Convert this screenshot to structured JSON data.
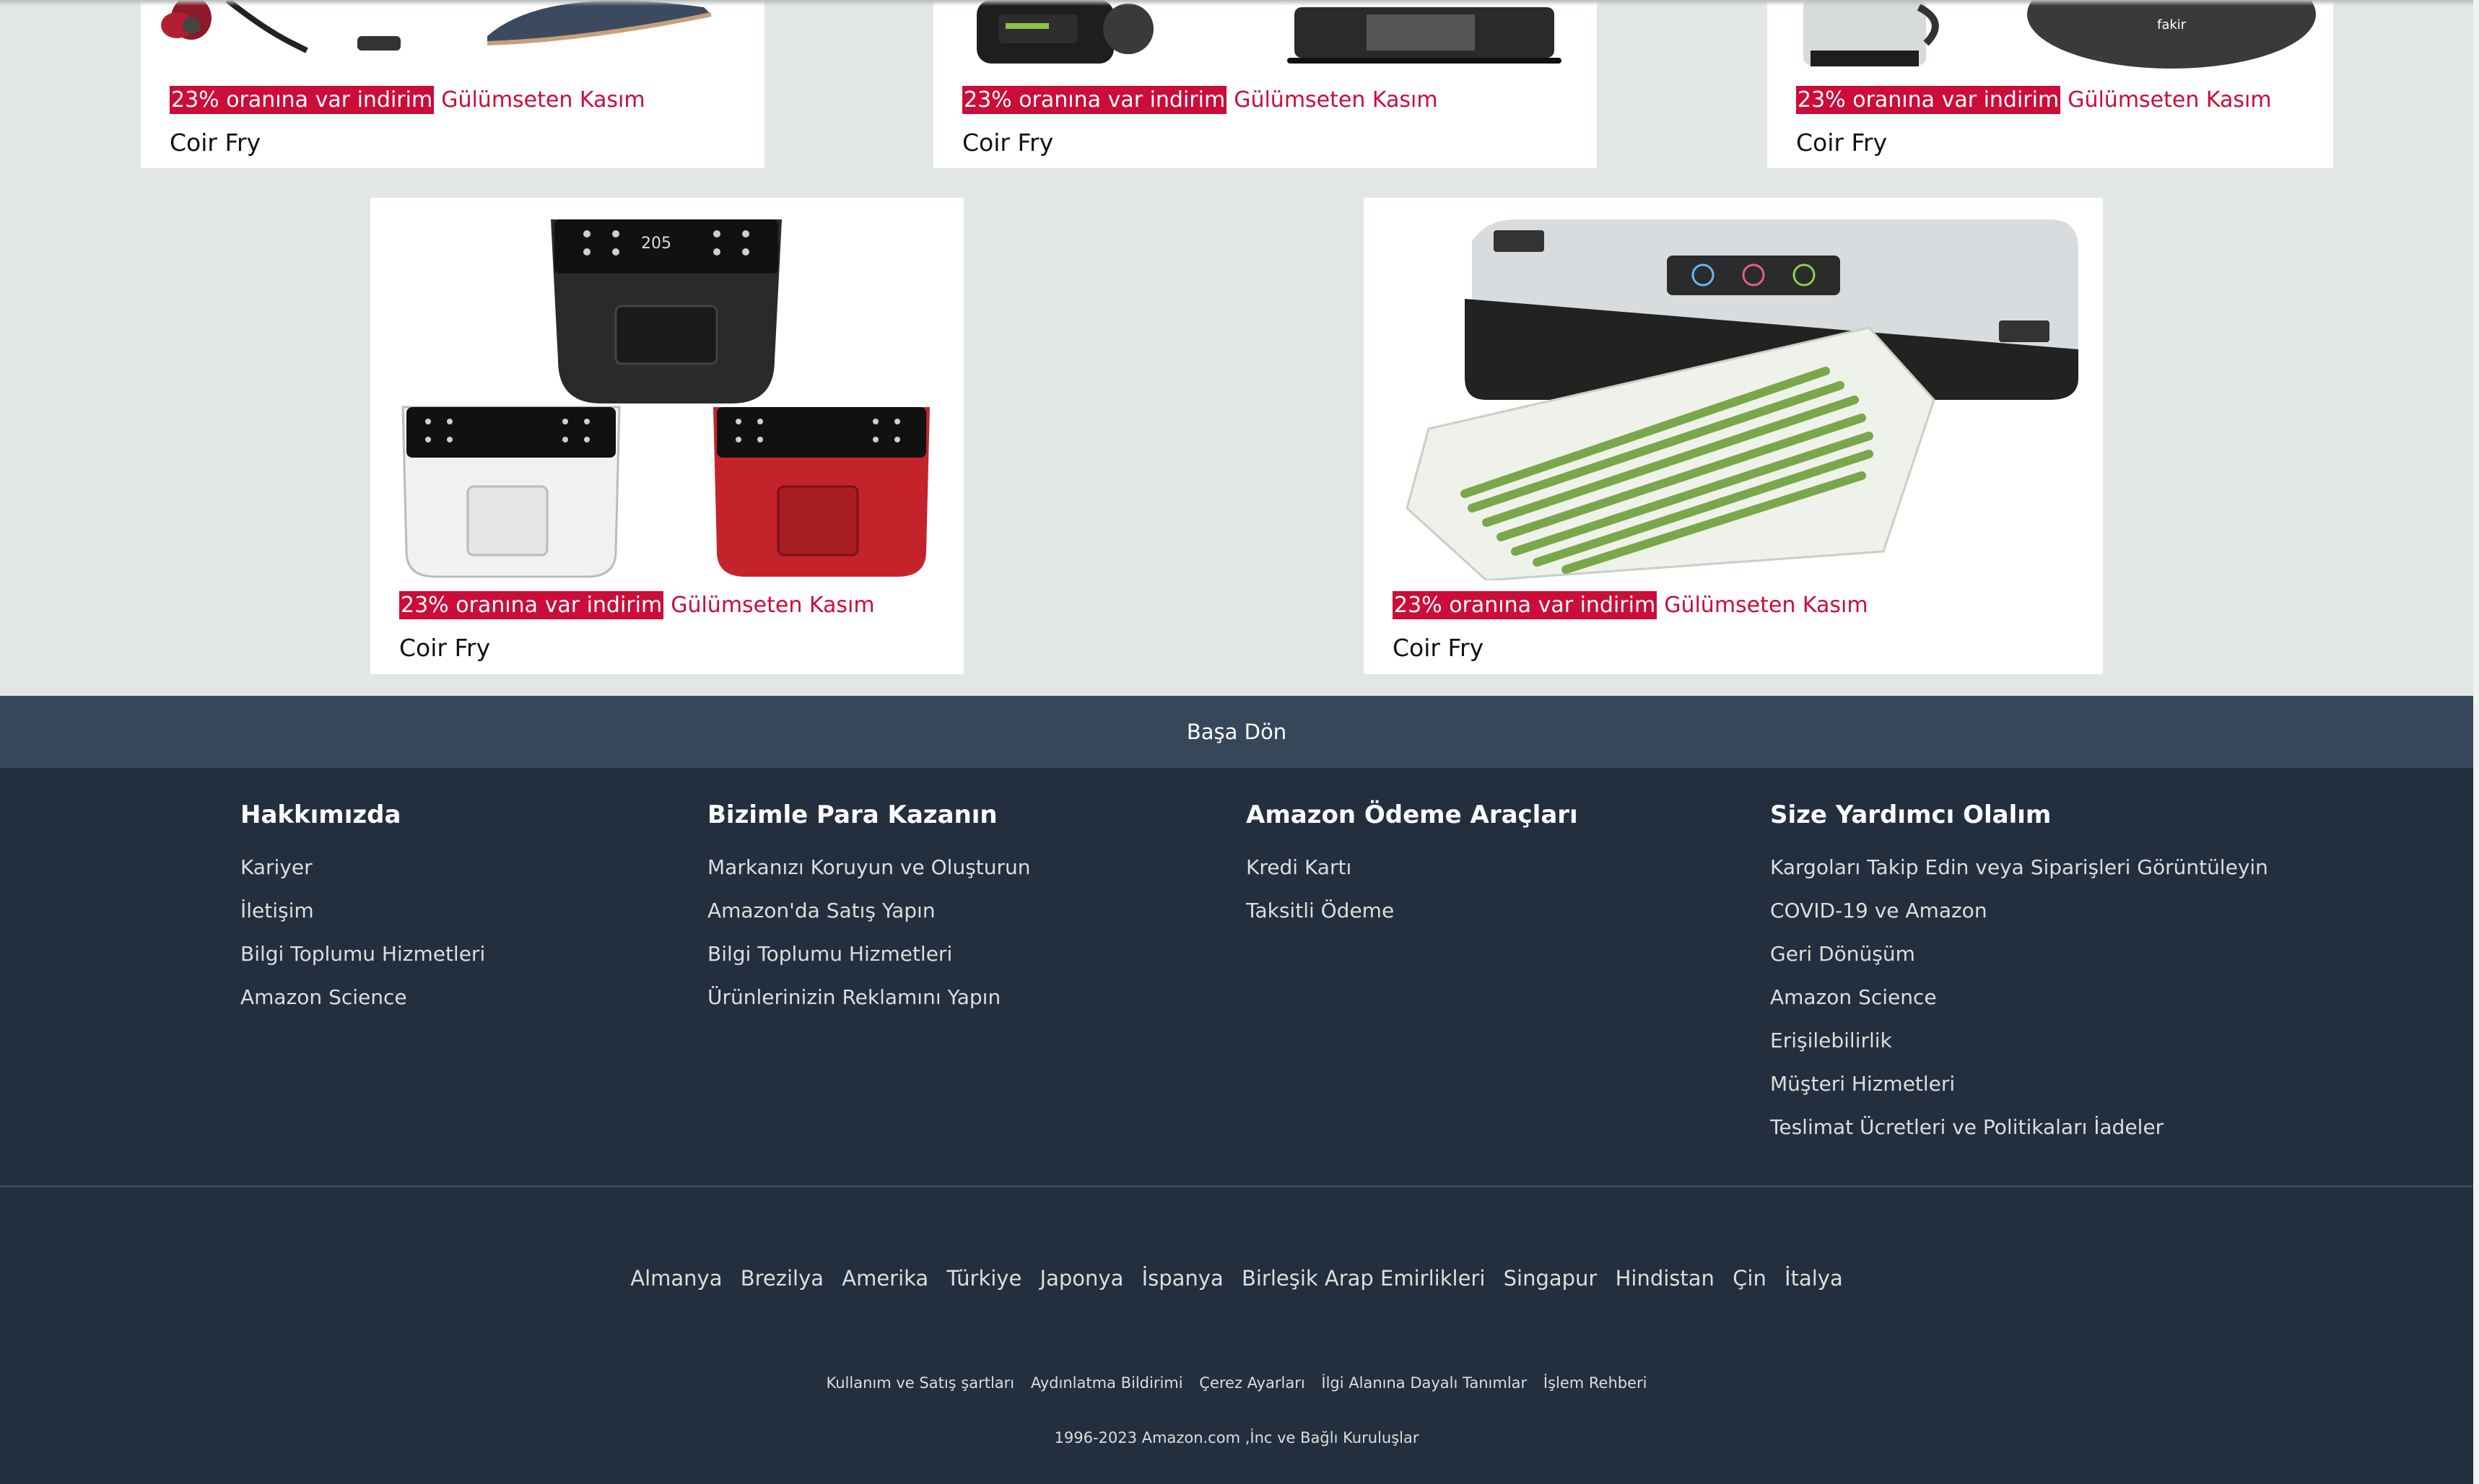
{
  "cards": [
    {
      "badge": "23% oranına var indirim",
      "deal": "Gülümseten Kasım",
      "name": "Coir Fry"
    },
    {
      "badge": "23% oranına var indirim",
      "deal": "Gülümseten Kasım",
      "name": "Coir Fry"
    },
    {
      "badge": "23% oranına var indirim",
      "deal": "Gülümseten Kasım",
      "name": "Coir Fry"
    },
    {
      "badge": "23% oranına var indirim",
      "deal": "Gülümseten Kasım",
      "name": "Coir Fry"
    },
    {
      "badge": "23% oranına var indirim",
      "deal": "Gülümseten Kasım",
      "name": "Coir Fry"
    }
  ],
  "back_to_top": "Başa Dön",
  "footer": {
    "columns": [
      {
        "title": "Hakkımızda",
        "links": [
          "Kariyer",
          "İletişim",
          "Bilgi Toplumu Hizmetleri",
          "Amazon Science"
        ]
      },
      {
        "title": "Bizimle Para Kazanın",
        "links": [
          "Markanızı Koruyun ve Oluşturun",
          "Amazon'da Satış Yapın",
          "Bilgi Toplumu Hizmetleri",
          "Ürünlerinizin Reklamını Yapın"
        ]
      },
      {
        "title": "Amazon Ödeme Araçları",
        "links": [
          "Kredi Kartı",
          "Taksitli Ödeme"
        ]
      },
      {
        "title": "Size Yardımcı Olalım",
        "links": [
          "Kargoları Takip Edin veya Siparişleri Görüntüleyin",
          "COVID-19 ve Amazon",
          "Geri Dönüşüm",
          "Amazon Science",
          "Erişilebilirlik",
          "Müşteri Hizmetleri",
          "Teslimat Ücretleri ve Politikaları İadeler"
        ]
      }
    ],
    "countries": [
      "Almanya",
      "Brezilya",
      "Amerika",
      "Türkiye",
      "Japonya",
      "İspanya",
      "Birleşik Arap Emirlikleri",
      "Singapur",
      "Hindistan",
      "Çin",
      "İtalya"
    ],
    "legal": [
      "Kullanım ve Satış şartları",
      "Aydınlatma Bildirimi",
      "Çerez Ayarları",
      "İlgi Alanına Dayalı Tanımlar",
      "İşlem Rehberi"
    ],
    "copyright": "1996-2023 Amazon.com ,İnc ve Bağlı Kuruluşlar"
  },
  "colors": {
    "badge": "#cc0c39",
    "footer_bg": "#232f3e",
    "back_to_top_bg": "#37475a",
    "page_bg": "#e3e6e6"
  }
}
